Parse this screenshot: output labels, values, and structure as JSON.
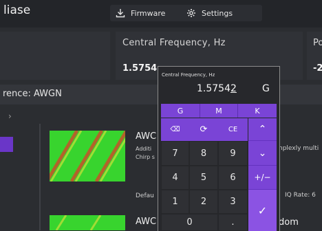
{
  "app": {
    "title": "liase"
  },
  "toolbar": {
    "firmware_label": "Firmware",
    "settings_label": "Settings"
  },
  "freq_card": {
    "label": "Central Frequency, Hz",
    "value": "1.5754"
  },
  "p_card": {
    "label": "Po",
    "value": "-2"
  },
  "interference_bar": {
    "text": "rence: AWGN"
  },
  "list": {
    "item1": {
      "title": "AWC",
      "desc_line1": "Additi",
      "desc_line2": "Chirp s",
      "right_desc": "nplexly multi",
      "default_label": "Defau",
      "iq_rate": "IQ Rate: 6"
    },
    "item2": {
      "title": "AWC",
      "right": "dom"
    }
  },
  "keypad": {
    "label": "Central Frequency, Hz",
    "value": "1.5754",
    "value_underlined": "2",
    "unit": "G",
    "multipliers": [
      "G",
      "M",
      "K"
    ],
    "backspace_glyph": "⌫",
    "reset_glyph": "⟳",
    "clear_label": "CE",
    "digits_row1": [
      "7",
      "8",
      "9"
    ],
    "digits_row2": [
      "4",
      "5",
      "6"
    ],
    "digits_row3": [
      "1",
      "2",
      "3"
    ],
    "zero": "0",
    "dot": ".",
    "up_glyph": "⌃",
    "down_glyph": "⌄",
    "sign_glyph": "+/−",
    "ok_glyph": "✓"
  },
  "colors": {
    "accent": "#7a44d6",
    "accent_light": "#8b53e3",
    "background": "#2b2d31",
    "card": "#303237",
    "thumb_green": "#38d42e",
    "thumb_red": "#c8502a"
  }
}
